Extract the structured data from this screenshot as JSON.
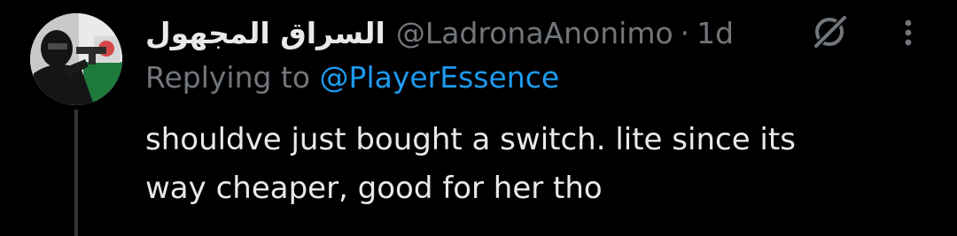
{
  "tweet": {
    "author": {
      "display_name": "السراق المجهول",
      "handle": "@LadronaAnonimo",
      "avatar_icon": "avatar-photo"
    },
    "separator": "·",
    "timestamp": "1d",
    "replying_to": {
      "prefix": "Replying to",
      "handle": "@PlayerEssence"
    },
    "text_lines": [
      "shouldve just bought a switch. lite since its",
      "way cheaper, good for her tho"
    ],
    "icons": {
      "grok": "grok-icon",
      "more": "more-icon"
    }
  },
  "colors": {
    "background": "#000000",
    "primary_text": "#e7e9ea",
    "secondary_text": "#71767b",
    "link": "#1d9bf0"
  }
}
